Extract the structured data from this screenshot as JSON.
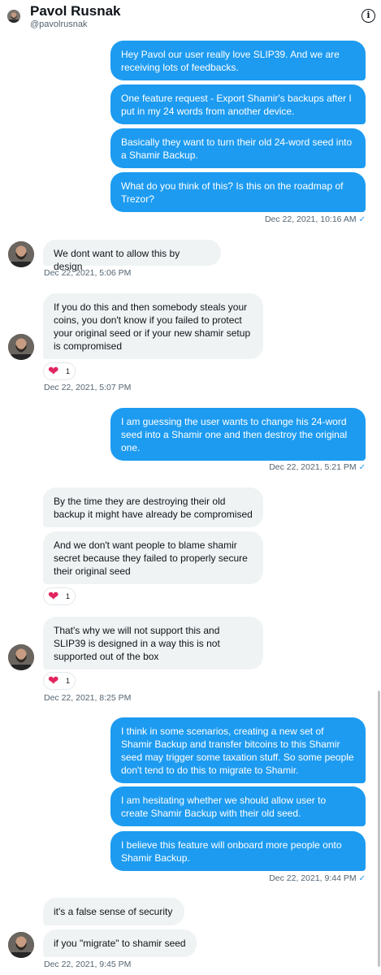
{
  "header": {
    "name": "Pavol Rusnak",
    "handle": "@pavolrusnak",
    "info_icon": "info-icon"
  },
  "colors": {
    "outgoing_bubble": "#1d9bf0",
    "incoming_bubble": "#eff3f4",
    "heart": "#e0245e"
  },
  "messages": [
    {
      "from": "me",
      "text": "Hey Pavol our user really love SLIP39. And we are receiving lots of feedbacks."
    },
    {
      "from": "me",
      "text": "One feature request - Export Shamir's backups after I put in my 24 words from another device."
    },
    {
      "from": "me",
      "text": "Basically they want to turn their old 24-word seed into a Shamir Backup."
    },
    {
      "from": "me",
      "text": "What do you think of this? Is this on the roadmap of Trezor?"
    },
    {
      "from": "them",
      "text": "We dont want to allow this by design"
    },
    {
      "from": "them",
      "text": "If you do this and then somebody steals your coins, you don't know if you failed to protect your original seed or if your new shamir setup is compromised"
    },
    {
      "from": "me",
      "text": "I am guessing the user wants to change his 24-word seed into a Shamir one and then destroy the original one."
    },
    {
      "from": "them",
      "text": "By the time they are destroying their old backup it might have already be compromised"
    },
    {
      "from": "them",
      "text": "And we don't want people to blame shamir secret because they failed to properly secure their original seed"
    },
    {
      "from": "them",
      "text": "That's why we will not support this and SLIP39 is designed in a way this is not supported out of the box"
    },
    {
      "from": "me",
      "text": "I think in some scenarios, creating a new set of Shamir Backup and transfer bitcoins to this Shamir seed may trigger some taxation stuff. So some people don't tend to do this to migrate to Shamir."
    },
    {
      "from": "me",
      "text": "I am hesitating whether we should allow user to create Shamir Backup with their old seed."
    },
    {
      "from": "me",
      "text": "I believe this feature will onboard more people onto Shamir Backup."
    },
    {
      "from": "them",
      "text": "it's a false sense of security"
    },
    {
      "from": "them",
      "text": "if you \"migrate\" to shamir seed"
    }
  ],
  "timestamps": [
    "Dec 22, 2021, 10:16 AM",
    "Dec 22, 2021, 5:06 PM",
    "Dec 22, 2021, 5:07 PM",
    "Dec 22, 2021, 5:21 PM",
    "Dec 22, 2021, 8:25 PM",
    "Dec 22, 2021, 9:44 PM",
    "Dec 22, 2021, 9:45 PM"
  ],
  "reactions": [
    {
      "emoji": "❤",
      "count": "1"
    },
    {
      "emoji": "❤",
      "count": "1"
    },
    {
      "emoji": "❤",
      "count": "1"
    }
  ],
  "read_check": "✓"
}
